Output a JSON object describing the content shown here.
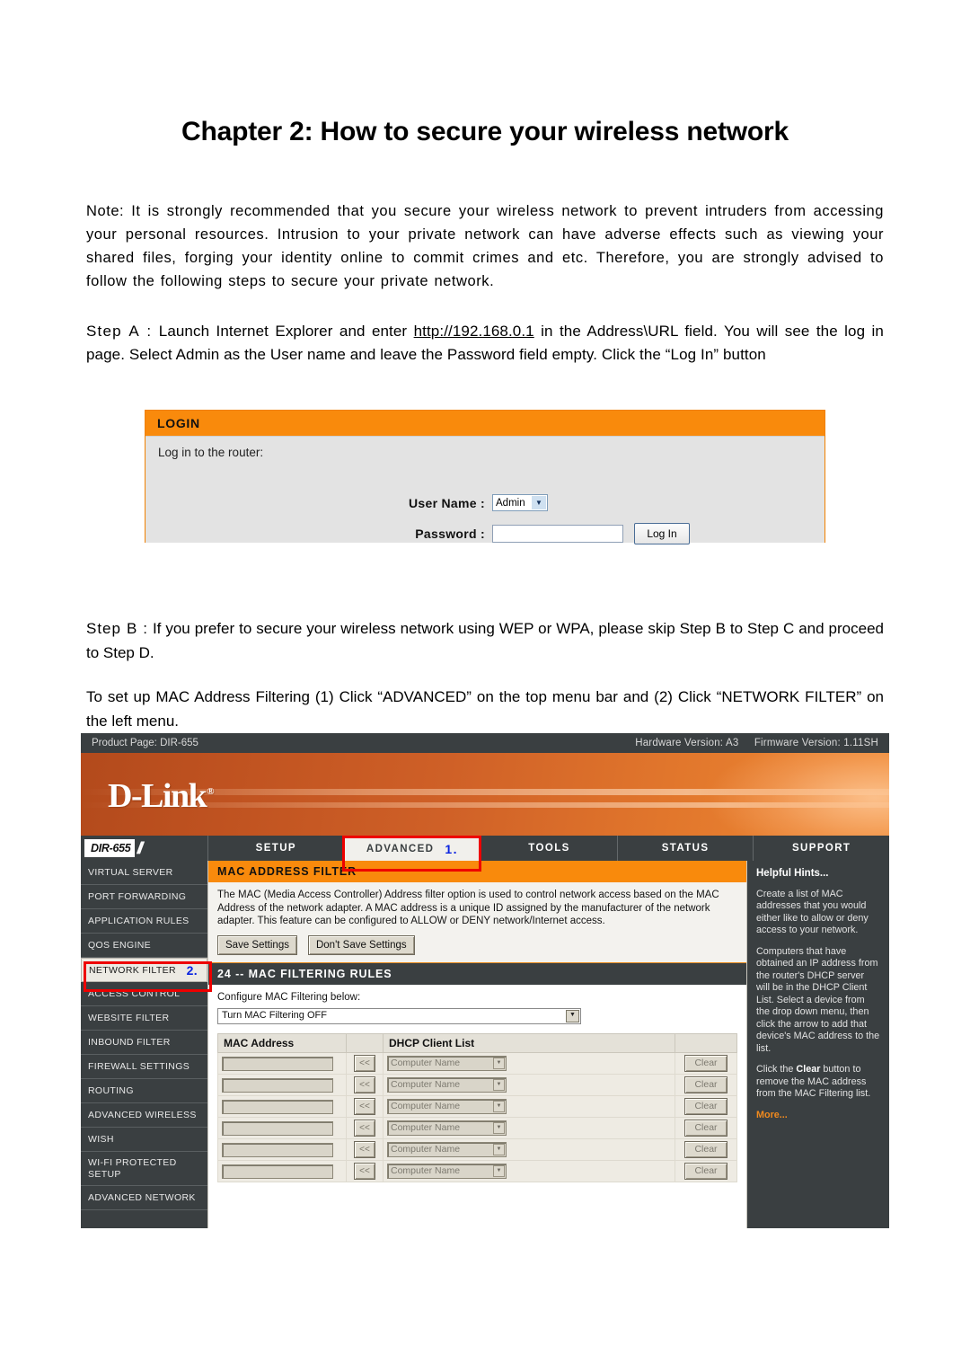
{
  "document": {
    "chapter_title": "Chapter 2: How to secure your wireless network",
    "note_paragraph": "Note: It is strongly recommended that you secure your wireless network to prevent intruders from accessing your personal resources. Intrusion to your private network can have adverse effects such as viewing your shared files, forging your identity online to commit crimes and etc. Therefore, you are strongly advised to follow the following steps to secure your private network.",
    "step_a": {
      "lead": "Step A :",
      "text_before_url": "Launch Internet Explorer and enter",
      "url": "http://192.168.0.1",
      "text_after_url": "in the Address\\URL field. You will see the log in page. Select Admin as the User name and leave the Password field empty. Click the “Log In” button"
    },
    "step_b": {
      "lead": "Step B :",
      "text": "If you prefer to secure your wireless network using WEP or WPA, please skip Step B to Step C and proceed to Step D."
    },
    "mac_intro": "To set up MAC Address Filtering (1) Click “ADVANCED” on the top menu bar and (2) Click “NETWORK FILTER” on the left menu."
  },
  "login_panel": {
    "header": "LOGIN",
    "subtitle": "Log in to the router:",
    "user_name_label": "User Name :",
    "user_name_value": "Admin",
    "password_label": "Password :",
    "password_value": "",
    "login_button": "Log In"
  },
  "router": {
    "product_bar": {
      "product_page": "Product Page: DIR-655",
      "hardware_version": "Hardware Version: A3",
      "firmware_version": "Firmware Version: 1.11SH"
    },
    "brand": "D-Link",
    "model_badge": "DIR-655",
    "nav_tabs": [
      {
        "label": "SETUP",
        "active": false,
        "marker": ""
      },
      {
        "label": "ADVANCED",
        "active": true,
        "marker": "1."
      },
      {
        "label": "TOOLS",
        "active": false,
        "marker": ""
      },
      {
        "label": "STATUS",
        "active": false,
        "marker": ""
      },
      {
        "label": "SUPPORT",
        "active": false,
        "marker": ""
      }
    ],
    "left_menu": [
      {
        "label": "VIRTUAL SERVER",
        "selected": false,
        "marker": ""
      },
      {
        "label": "PORT FORWARDING",
        "selected": false,
        "marker": ""
      },
      {
        "label": "APPLICATION RULES",
        "selected": false,
        "marker": ""
      },
      {
        "label": "QOS ENGINE",
        "selected": false,
        "marker": ""
      },
      {
        "label": "NETWORK FILTER",
        "selected": true,
        "marker": "2."
      },
      {
        "label": "ACCESS CONTROL",
        "selected": false,
        "marker": ""
      },
      {
        "label": "WEBSITE FILTER",
        "selected": false,
        "marker": ""
      },
      {
        "label": "INBOUND FILTER",
        "selected": false,
        "marker": ""
      },
      {
        "label": "FIREWALL SETTINGS",
        "selected": false,
        "marker": ""
      },
      {
        "label": "ROUTING",
        "selected": false,
        "marker": ""
      },
      {
        "label": "ADVANCED WIRELESS",
        "selected": false,
        "marker": ""
      },
      {
        "label": "WISH",
        "selected": false,
        "marker": ""
      },
      {
        "label": "WI-FI PROTECTED SETUP",
        "selected": false,
        "marker": ""
      },
      {
        "label": "ADVANCED NETWORK",
        "selected": false,
        "marker": ""
      }
    ],
    "mac_filter_panel": {
      "title": "MAC ADDRESS FILTER",
      "description": "The MAC (Media Access Controller) Address filter option is used to control network access based on the MAC Address of the network adapter. A MAC address is a unique ID assigned by the manufacturer of the network adapter. This feature can be configured to ALLOW or DENY network/Internet access.",
      "save_button": "Save Settings",
      "dont_save_button": "Don't Save Settings"
    },
    "rules_panel": {
      "title": "24 -- MAC FILTERING RULES",
      "configure_label": "Configure MAC Filtering below:",
      "filter_mode_value": "Turn MAC Filtering OFF",
      "columns": [
        "MAC Address",
        "",
        "DHCP Client List",
        ""
      ],
      "arrow_button": "<<",
      "clear_button": "Clear",
      "dhcp_placeholder": "Computer Name",
      "rows": [
        {
          "mac": "",
          "dhcp": "Computer Name"
        },
        {
          "mac": "",
          "dhcp": "Computer Name"
        },
        {
          "mac": "",
          "dhcp": "Computer Name"
        },
        {
          "mac": "",
          "dhcp": "Computer Name"
        },
        {
          "mac": "",
          "dhcp": "Computer Name"
        },
        {
          "mac": "",
          "dhcp": "Computer Name"
        }
      ]
    },
    "helpful_hints": {
      "title": "Helpful Hints...",
      "p1": "Create a list of MAC addresses that you would either like to allow or deny access to your network.",
      "p2_a": "Computers that have obtained an IP address from the router's DHCP server will be in the DHCP Client List. Select a device from the drop down menu, then click the arrow to add that device's MAC address to the list.",
      "p3_before": "Click the ",
      "p3_bold": "Clear",
      "p3_after": " button to remove the MAC address from the MAC Filtering list.",
      "more": "More..."
    }
  },
  "colors": {
    "orange_header": "#f98a0c",
    "dark_panel": "#3a3f41",
    "banner_left": "#b34a1c",
    "banner_right": "#ef8a33",
    "highlight_red": "#ee0000",
    "marker_blue": "#0a24e0",
    "hint_link": "#f08a1e"
  }
}
